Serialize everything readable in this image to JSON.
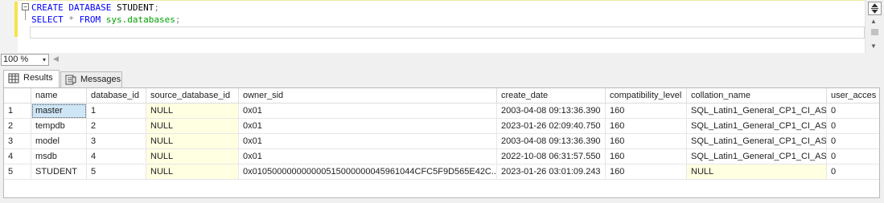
{
  "editor": {
    "line1": {
      "kw1": "CREATE",
      "kw2": "DATABASE",
      "name": "STUDENT",
      "semi": ";"
    },
    "line2": {
      "kw1": "SELECT",
      "star": "*",
      "kw2": "FROM",
      "obj": "sys.databases",
      "semi": ";"
    },
    "collapse_glyph": "⊟",
    "splitter_glyph": "⇕"
  },
  "zoom": {
    "value": "100 %",
    "arrow": "▾"
  },
  "tabs": [
    {
      "label": "Results",
      "icon": "grid-icon",
      "active": true
    },
    {
      "label": "Messages",
      "icon": "messages-icon",
      "active": false
    }
  ],
  "grid": {
    "columns": [
      "name",
      "database_id",
      "source_database_id",
      "owner_sid",
      "create_date",
      "compatibility_level",
      "collation_name",
      "user_acces"
    ],
    "rows": [
      {
        "num": "1",
        "cells": [
          "master",
          "1",
          "NULL",
          "0x01",
          "2003-04-08 09:13:36.390",
          "160",
          "SQL_Latin1_General_CP1_CI_AS",
          "0"
        ]
      },
      {
        "num": "2",
        "cells": [
          "tempdb",
          "2",
          "NULL",
          "0x01",
          "2023-01-26 02:09:40.750",
          "160",
          "SQL_Latin1_General_CP1_CI_AS",
          "0"
        ]
      },
      {
        "num": "3",
        "cells": [
          "model",
          "3",
          "NULL",
          "0x01",
          "2003-04-08 09:13:36.390",
          "160",
          "SQL_Latin1_General_CP1_CI_AS",
          "0"
        ]
      },
      {
        "num": "4",
        "cells": [
          "msdb",
          "4",
          "NULL",
          "0x01",
          "2022-10-08 06:31:57.550",
          "160",
          "SQL_Latin1_General_CP1_CI_AS",
          "0"
        ]
      },
      {
        "num": "5",
        "cells": [
          "STUDENT",
          "5",
          "NULL",
          "0x010500000000000515000000045961044CFC5F9D565E42C...",
          "2023-01-26 03:01:09.243",
          "160",
          "NULL",
          "0"
        ]
      }
    ],
    "selected": {
      "row": 0,
      "col": 0
    }
  },
  "colors": {
    "keyword": "#0000ff",
    "system_object": "#00a000",
    "operator": "#808080",
    "null_background": "#ffffe1",
    "selection": "#cfe6f7",
    "change_bar": "#f6e34a"
  }
}
